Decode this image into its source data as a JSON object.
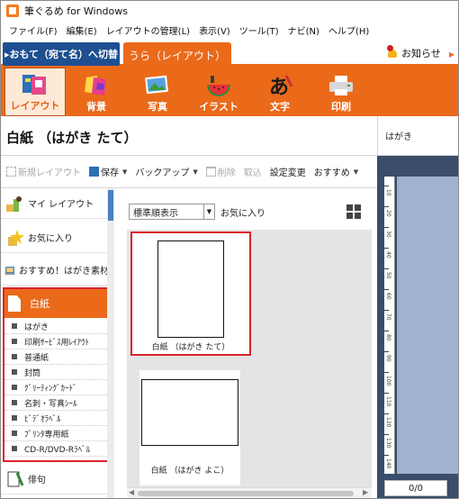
{
  "window": {
    "title": "筆ぐるめ for Windows"
  },
  "menu": [
    "ファイル(F)",
    "編集(E)",
    "レイアウトの管理(L)",
    "表示(V)",
    "ツール(T)",
    "ナビ(N)",
    "ヘルプ(H)"
  ],
  "mode": {
    "front_button": "▸おもて（宛て名）へ切替",
    "back_tab": "うら（レイアウト）",
    "notice": "お知らせ"
  },
  "categories": [
    {
      "label": "レイアウト",
      "icon": "layout-icon",
      "active": true
    },
    {
      "label": "背景",
      "icon": "background-icon",
      "active": false
    },
    {
      "label": "写真",
      "icon": "photo-icon",
      "active": false
    },
    {
      "label": "イラスト",
      "icon": "illustration-icon",
      "active": false
    },
    {
      "label": "文字",
      "icon": "text-icon",
      "active": false
    },
    {
      "label": "印刷",
      "icon": "print-icon",
      "active": false
    }
  ],
  "page_title": "白紙 （はがき たて）",
  "preview": {
    "title": "はがき",
    "page_counter": "0/0"
  },
  "actions": {
    "new_layout": "新規レイアウト",
    "save": "保存",
    "backup": "バックアップ",
    "delete": "削除",
    "import": "取込",
    "settings": "設定変更",
    "recommend": "おすすめ"
  },
  "sidebar": {
    "items": [
      {
        "label": "マイ レイアウト"
      },
      {
        "label": "お気に入り"
      },
      {
        "label": "おすすめ！はがき素材"
      }
    ],
    "selected_group": "白紙",
    "sub_items": [
      "はがき",
      "印刷ｻｰﾋﾞｽ用ﾚｲｱｳﾄ",
      "普通紙",
      "封筒",
      "ｸﾞﾘｰﾃｨﾝｸﾞｶｰﾄﾞ",
      "名刺・写真ｼｰﾙ",
      "ﾋﾞﾃﾞｵﾗﾍﾞﾙ",
      "ﾌﾟﾘﾝﾀ専用紙",
      "CD-R/DVD-Rﾗﾍﾞﾙ"
    ],
    "last_item": "俳句"
  },
  "gallery": {
    "sort": "標準順表示",
    "favorites": "お気に入り",
    "cards": [
      {
        "caption": "白紙 （はがき たて）",
        "selected": true
      },
      {
        "caption": "白紙 （はがき よこ）",
        "selected": false
      }
    ]
  },
  "ruler_numbers": [
    "10",
    "20",
    "30",
    "40",
    "50",
    "60",
    "70",
    "80",
    "90",
    "100",
    "110",
    "120",
    "130",
    "140"
  ],
  "colors": {
    "accent": "#ea6a1a",
    "front_button": "#1d4f91",
    "selection": "#d9232c",
    "preview_bg": "#3a4d6a"
  }
}
